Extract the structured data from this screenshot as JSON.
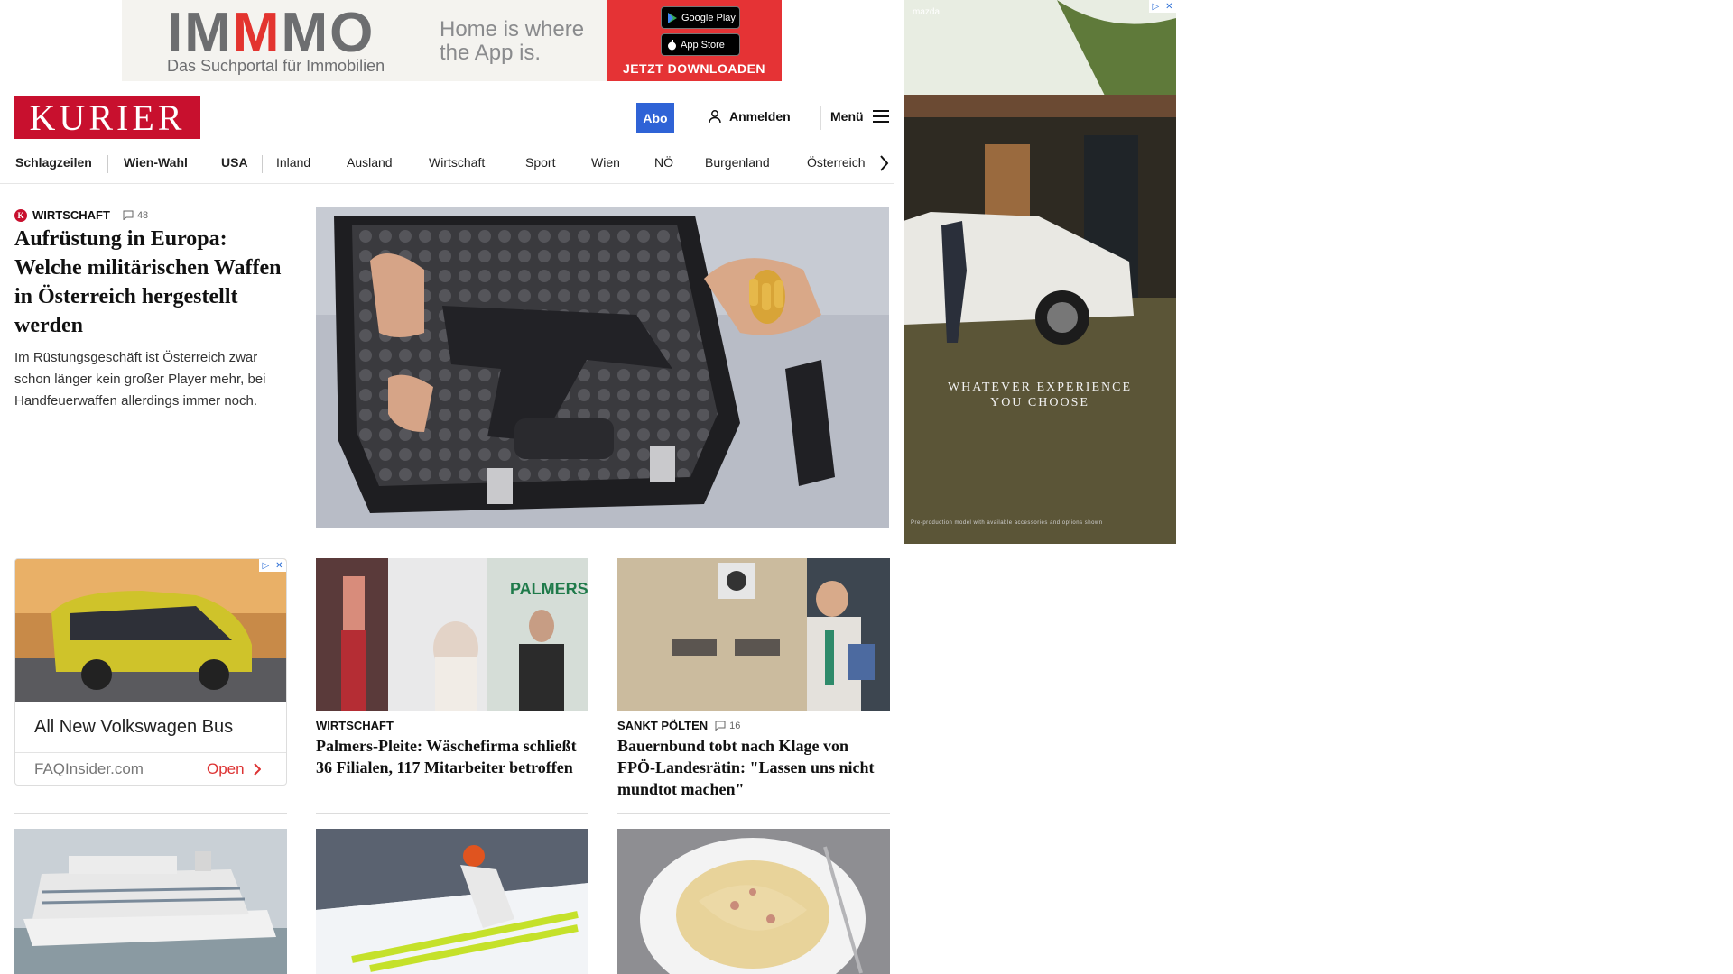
{
  "banner_ad": {
    "logo_left": "IM",
    "logo_mid": "M",
    "logo_right": "MO",
    "subtitle": "Das Suchportal für Immobilien",
    "slogan": "Home is where the App is.",
    "google_play": "Google Play",
    "app_store": "App Store",
    "cta": "JETZT DOWNLOADEN"
  },
  "header": {
    "brand": "KURIER",
    "abo": "Abo",
    "login": "Anmelden",
    "menu": "Menü"
  },
  "nav": {
    "items": [
      "Schlagzeilen",
      "Wien-Wahl",
      "USA",
      "Inland",
      "Ausland",
      "Wirtschaft",
      "Sport",
      "Wien",
      "NÖ",
      "Burgenland",
      "Österreich"
    ]
  },
  "lead": {
    "kicker": "Wirtschaft",
    "comments": "48",
    "title": "Aufrüstung in Europa: Welche militärischen Waffen in Österreich hergestellt werden",
    "teaser": "Im Rüstungsgeschäft ist Österreich zwar schon länger kein großer Player mehr, bei Handfeuerwaffen allerdings immer noch."
  },
  "side_ad": {
    "brand": "mazda",
    "claim_line1": "WHATEVER EXPERIENCE",
    "claim_line2": "YOU CHOOSE",
    "fine_print": "Pre-production model with available accessories and options shown"
  },
  "ad_card": {
    "title": "All New Volkswagen Bus",
    "source": "FAQInsider.com",
    "open": "Open"
  },
  "cards": [
    {
      "kicker": "Wirtschaft",
      "title": "Palmers-Pleite: Wäschefirma schließt 36 Filialen, 117 Mitarbeiter betroffen"
    },
    {
      "kicker": "Sankt Pölten",
      "comments": "16",
      "title": "Bauernbund tobt nach Klage von FPÖ-Landesrätin: \"Lassen uns nicht mundtot machen\""
    }
  ],
  "icons": [
    "person-icon",
    "hamburger-icon",
    "chevron-right-icon",
    "comment-icon",
    "ad-choices-icon",
    "close-icon"
  ]
}
